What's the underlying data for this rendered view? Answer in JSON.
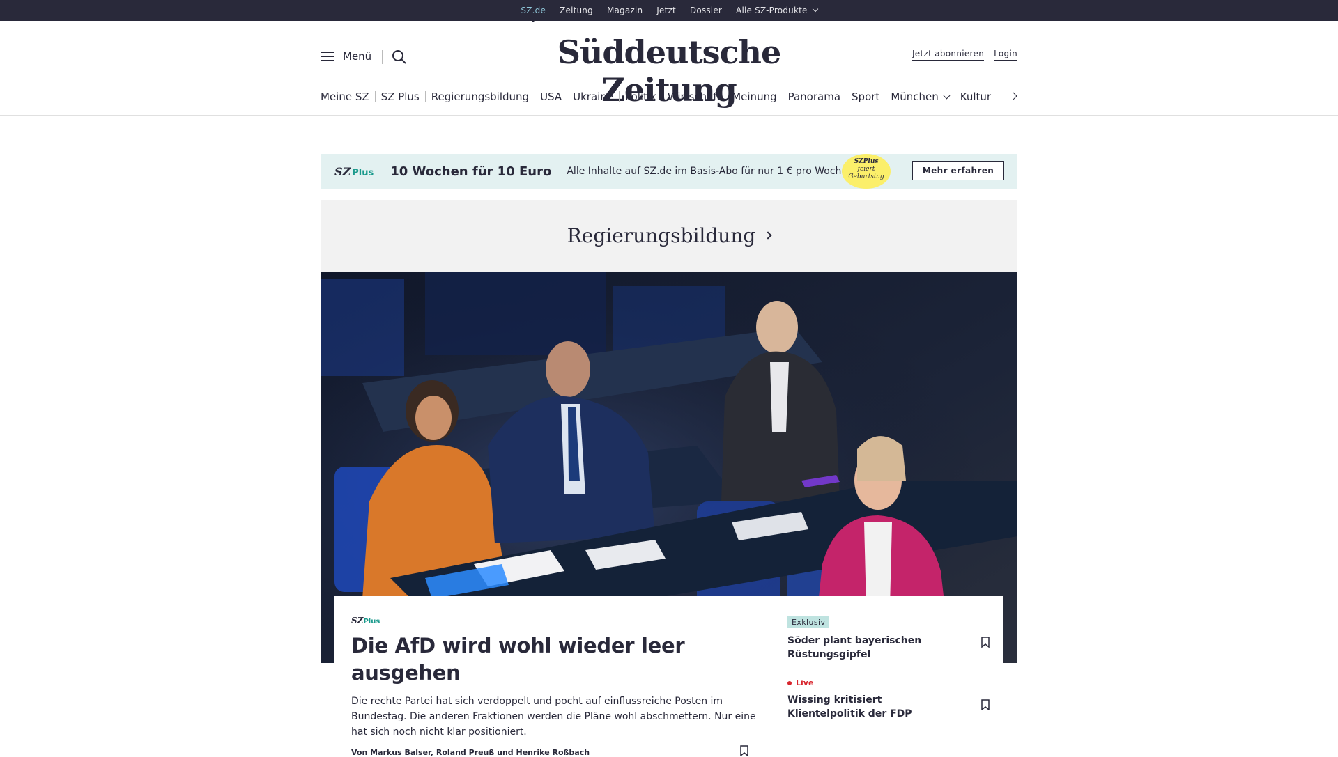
{
  "topbar": {
    "items": [
      "SZ.de",
      "Zeitung",
      "Magazin",
      "Jetzt",
      "Dossier",
      "Alle SZ-Produkte"
    ]
  },
  "header": {
    "menu_label": "Menü",
    "logo": "Süddeutsche Zeitung",
    "subscribe": "Jetzt abonnieren",
    "login": "Login"
  },
  "ressorts": [
    "Meine SZ",
    "SZ Plus",
    "Regierungsbildung",
    "USA",
    "Ukraine",
    "Politik",
    "Wirtschaft",
    "Meinung",
    "Panorama",
    "Sport",
    "München",
    "Kultur"
  ],
  "promo": {
    "brand": "SZ",
    "brand_plus": "Plus",
    "headline": "10 Wochen für 10 Euro",
    "text": "Alle Inhalte auf SZ.de im Basis-Abo für nur 1 € pro Woche.",
    "badge_line1": "SZPlus",
    "badge_line2": "feiert",
    "badge_line3": "Geburtstag",
    "cta": "Mehr erfahren"
  },
  "topic": {
    "title": "Regierungsbildung"
  },
  "lead_article": {
    "kicker_brand": "SZ",
    "kicker_plus": "Plus",
    "headline": "Die AfD wird wohl wieder leer ausgehen",
    "teaser": "Die rechte Partei hat sich verdoppelt und pocht auf einflussreiche Posten im Bundestag. Die anderen Fraktionen werden die Pläne wohl abschmettern. Nur eine hat sich noch nicht klar positioniert.",
    "byline": "Von Markus Balser, Roland Preuß und Henrike Roßbach"
  },
  "side_articles": [
    {
      "label": "Exklusiv",
      "title": "Söder plant bayerischen Rüstungsgipfel"
    },
    {
      "label": "Live",
      "title": "Wissing kritisiert Klientelpolitik der FDP"
    }
  ],
  "colors": {
    "dark": "#29293a",
    "accent_teal": "#1a9a8c",
    "promo_bg": "#e3f1f1",
    "live_red": "#d8262e",
    "badge_yellow": "#fbef6a"
  }
}
